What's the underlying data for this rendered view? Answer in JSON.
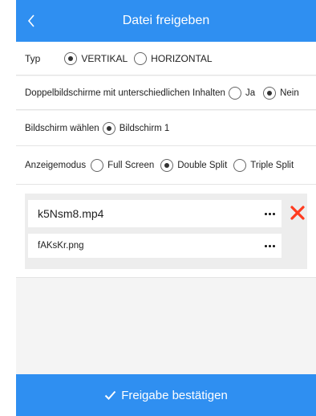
{
  "header": {
    "title": "Datei freigeben",
    "back_icon": "chevron-left-icon"
  },
  "settings": {
    "type": {
      "label": "Typ",
      "options": [
        {
          "label": "VERTIKAL",
          "selected": true
        },
        {
          "label": "HORIZONTAL",
          "selected": false
        }
      ]
    },
    "dual_screen": {
      "label": "Doppelbildschirme mit unterschiedlichen Inhalten",
      "options": [
        {
          "label": "Ja",
          "selected": false
        },
        {
          "label": "Nein",
          "selected": true
        }
      ]
    },
    "screen": {
      "label": "Bildschirm wählen",
      "options": [
        {
          "label": "Bildschirm 1",
          "selected": true
        }
      ]
    },
    "display_mode": {
      "label": "Anzeigemodus",
      "options": [
        {
          "label": "Full Screen",
          "selected": false
        },
        {
          "label": "Double Split",
          "selected": true
        },
        {
          "label": "Triple Split",
          "selected": false
        }
      ]
    }
  },
  "files": [
    {
      "name": "k5Nsm8.mp4"
    },
    {
      "name": "fAKsKr.png"
    }
  ],
  "footer": {
    "confirm_label": "Freigabe bestätigen"
  },
  "colors": {
    "primary": "#2f8ff1",
    "remove": "#ff3b1f"
  }
}
